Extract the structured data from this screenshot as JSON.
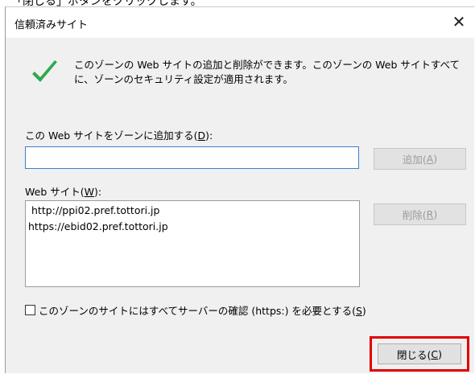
{
  "caption": "「閉じる」ボタンをクリックします。",
  "dialog": {
    "title": "信頼済みサイト",
    "close_glyph": "✕",
    "description": "このゾーンの Web サイトの追加と削除ができます。このゾーンの Web サイトすべてに、ゾーンのセキュリティ設定が適用されます。",
    "add_label_prefix": "この Web サイトをゾーンに追加する(",
    "add_label_key": "D",
    "add_label_suffix": "):",
    "add_input_value": "",
    "add_button_prefix": "追加(",
    "add_button_key": "A",
    "add_button_suffix": ")",
    "sites_label_prefix": "Web サイト(",
    "sites_label_key": "W",
    "sites_label_suffix": "):",
    "sites": [
      "http://ppi02.pref.tottori.jp",
      "https://ebid02.pref.tottori.jp"
    ],
    "remove_button_prefix": "削除(",
    "remove_button_key": "R",
    "remove_button_suffix": ")",
    "https_label_prefix": "このゾーンのサイトにはすべてサーバーの確認 (https:) を必要とする(",
    "https_label_key": "S",
    "https_label_suffix": ")",
    "https_checked": false,
    "close_button_prefix": "閉じる(",
    "close_button_key": "C",
    "close_button_suffix": ")"
  },
  "colors": {
    "check_green": "#2fa84f",
    "highlight_red": "#e00000",
    "input_focus_border": "#3c7fd0"
  },
  "icons": {
    "status": "checkmark-icon",
    "close": "close-icon"
  }
}
